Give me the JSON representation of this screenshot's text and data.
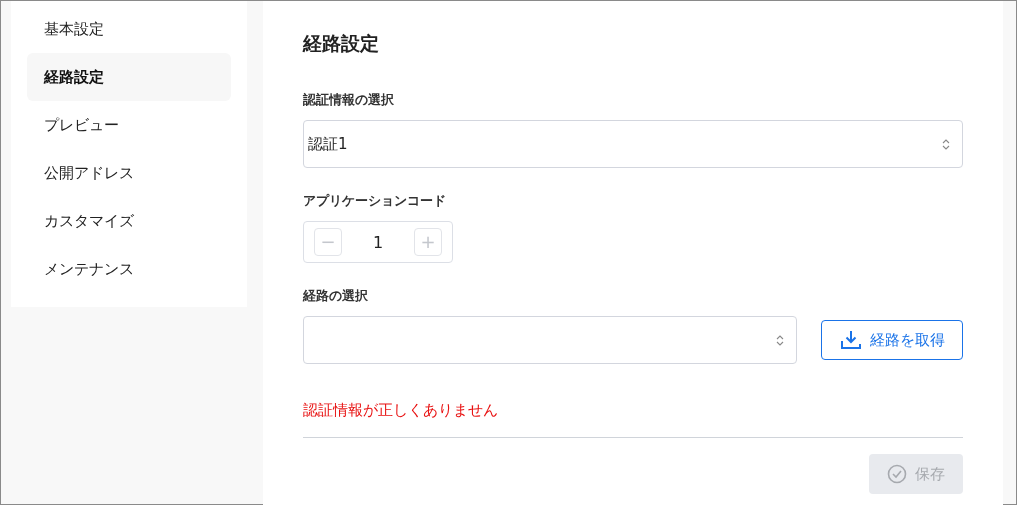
{
  "sidebar": {
    "items": [
      {
        "label": "基本設定",
        "selected": false
      },
      {
        "label": "経路設定",
        "selected": true
      },
      {
        "label": "プレビュー",
        "selected": false
      },
      {
        "label": "公開アドレス",
        "selected": false
      },
      {
        "label": "カスタマイズ",
        "selected": false
      },
      {
        "label": "メンテナンス",
        "selected": false
      }
    ]
  },
  "main": {
    "title": "経路設定",
    "credential": {
      "label": "認証情報の選択",
      "value": "認証1"
    },
    "app_code": {
      "label": "アプリケーションコード",
      "decrement": "−",
      "value": "1",
      "increment": "+"
    },
    "route": {
      "label": "経路の選択",
      "fetch_button": "経路を取得"
    },
    "error": "認証情報が正しくありません",
    "save_button": {
      "label": "保存",
      "disabled": true
    }
  }
}
